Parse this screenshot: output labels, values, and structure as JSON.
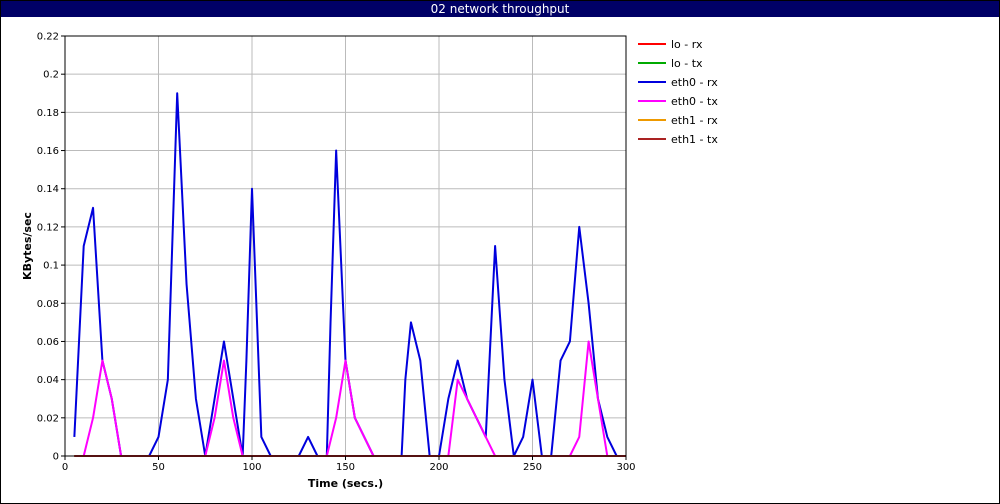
{
  "window": {
    "title": "02 network throughput"
  },
  "chart_data": {
    "type": "line",
    "title": "02 network throughput",
    "xlabel": "Time (secs.)",
    "ylabel": "KBytes/sec",
    "xlim": [
      0,
      300
    ],
    "ylim": [
      0,
      0.22
    ],
    "xticks": [
      0,
      50,
      100,
      150,
      200,
      250,
      300
    ],
    "yticks": [
      0,
      0.02,
      0.04,
      0.06,
      0.08,
      0.1,
      0.12,
      0.14,
      0.16,
      0.18,
      0.2,
      0.22
    ],
    "grid": true,
    "legend_position": "right",
    "series": [
      {
        "name": "lo - rx",
        "color": "#ff0000",
        "points": [
          [
            5,
            0
          ],
          [
            300,
            0
          ]
        ]
      },
      {
        "name": "lo - tx",
        "color": "#00aa00",
        "points": [
          [
            5,
            0
          ],
          [
            300,
            0
          ]
        ]
      },
      {
        "name": "eth0 - rx",
        "color": "#0000dd",
        "points": [
          [
            5,
            0.01
          ],
          [
            7,
            0.05
          ],
          [
            10,
            0.11
          ],
          [
            15,
            0.13
          ],
          [
            20,
            0.05
          ],
          [
            25,
            0.03
          ],
          [
            30,
            0
          ],
          [
            45,
            0
          ],
          [
            50,
            0.01
          ],
          [
            55,
            0.04
          ],
          [
            60,
            0.19
          ],
          [
            65,
            0.09
          ],
          [
            70,
            0.03
          ],
          [
            75,
            0
          ],
          [
            80,
            0.03
          ],
          [
            85,
            0.06
          ],
          [
            90,
            0.03
          ],
          [
            95,
            0
          ],
          [
            97,
            0.05
          ],
          [
            100,
            0.14
          ],
          [
            105,
            0.01
          ],
          [
            110,
            0
          ],
          [
            125,
            0
          ],
          [
            130,
            0.01
          ],
          [
            135,
            0
          ],
          [
            140,
            0
          ],
          [
            142,
            0.07
          ],
          [
            145,
            0.16
          ],
          [
            150,
            0.05
          ],
          [
            155,
            0.02
          ],
          [
            165,
            0
          ],
          [
            180,
            0
          ],
          [
            182,
            0.04
          ],
          [
            185,
            0.07
          ],
          [
            190,
            0.05
          ],
          [
            195,
            0
          ],
          [
            200,
            0
          ],
          [
            205,
            0.03
          ],
          [
            210,
            0.05
          ],
          [
            215,
            0.03
          ],
          [
            220,
            0.02
          ],
          [
            225,
            0.01
          ],
          [
            230,
            0.11
          ],
          [
            235,
            0.04
          ],
          [
            240,
            0
          ],
          [
            245,
            0.01
          ],
          [
            250,
            0.04
          ],
          [
            255,
            0
          ],
          [
            260,
            0
          ],
          [
            265,
            0.05
          ],
          [
            270,
            0.06
          ],
          [
            275,
            0.12
          ],
          [
            280,
            0.08
          ],
          [
            285,
            0.03
          ],
          [
            290,
            0.01
          ],
          [
            295,
            0
          ],
          [
            300,
            0
          ]
        ]
      },
      {
        "name": "eth0 - tx",
        "color": "#ff00ff",
        "points": [
          [
            5,
            0
          ],
          [
            10,
            0
          ],
          [
            15,
            0.02
          ],
          [
            20,
            0.05
          ],
          [
            25,
            0.03
          ],
          [
            30,
            0
          ],
          [
            70,
            0
          ],
          [
            75,
            0
          ],
          [
            80,
            0.02
          ],
          [
            85,
            0.05
          ],
          [
            90,
            0.02
          ],
          [
            95,
            0
          ],
          [
            140,
            0
          ],
          [
            145,
            0.02
          ],
          [
            150,
            0.05
          ],
          [
            155,
            0.02
          ],
          [
            160,
            0.01
          ],
          [
            165,
            0
          ],
          [
            205,
            0
          ],
          [
            210,
            0.04
          ],
          [
            215,
            0.03
          ],
          [
            220,
            0.02
          ],
          [
            225,
            0.01
          ],
          [
            230,
            0
          ],
          [
            270,
            0
          ],
          [
            275,
            0.01
          ],
          [
            280,
            0.06
          ],
          [
            285,
            0.03
          ],
          [
            290,
            0
          ],
          [
            300,
            0
          ]
        ]
      },
      {
        "name": "eth1 - rx",
        "color": "#ee9900",
        "points": [
          [
            5,
            0
          ],
          [
            300,
            0
          ]
        ]
      },
      {
        "name": "eth1 - tx",
        "color": "#aa2222",
        "points": [
          [
            5,
            0
          ],
          [
            300,
            0
          ]
        ]
      }
    ]
  }
}
